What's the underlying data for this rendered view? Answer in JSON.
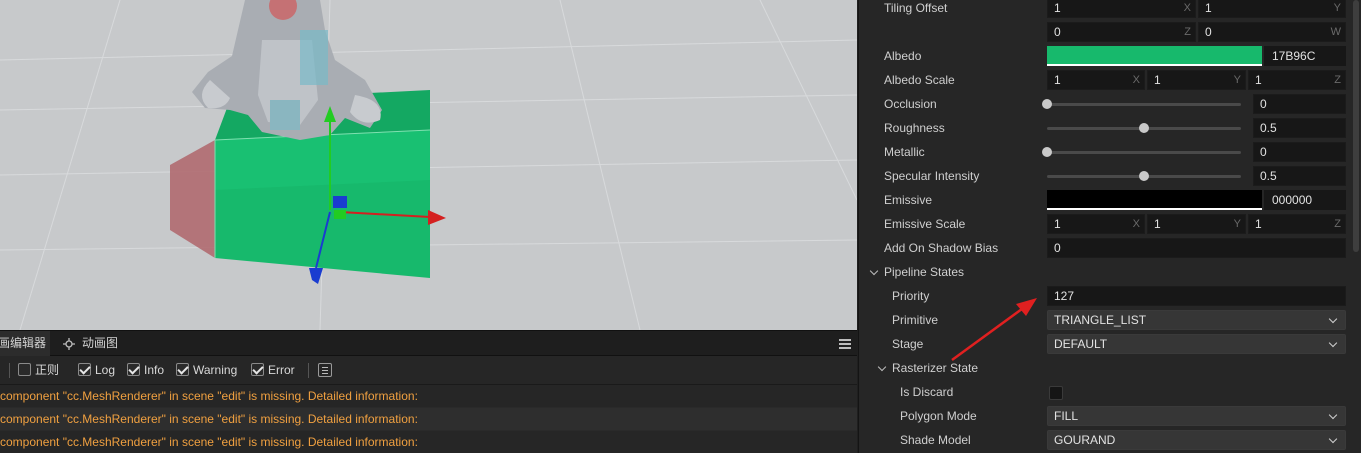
{
  "console": {
    "tabs": [
      "画编辑器",
      "动画图"
    ],
    "filters": [
      {
        "label": "正则",
        "checked": false
      },
      {
        "label": "Log",
        "checked": true
      },
      {
        "label": "Info",
        "checked": true
      },
      {
        "label": "Warning",
        "checked": true
      },
      {
        "label": "Error",
        "checked": true
      }
    ],
    "logs": [
      "component \"cc.MeshRenderer\" in scene \"edit\" is missing. Detailed information:",
      "component \"cc.MeshRenderer\" in scene \"edit\" is missing. Detailed information:",
      "component \"cc.MeshRenderer\" in scene \"edit\" is missing. Detailed information:"
    ]
  },
  "inspector": {
    "tiling_offset": {
      "label": "Tiling Offset",
      "x": "1",
      "y": "1",
      "z": "0",
      "w": "0",
      "axes": [
        "X",
        "Y",
        "Z",
        "W"
      ]
    },
    "albedo": {
      "label": "Albedo",
      "hex": "17B96C",
      "color": "#17B96C"
    },
    "albedo_scale": {
      "label": "Albedo Scale",
      "x": "1",
      "y": "1",
      "z": "1"
    },
    "occlusion": {
      "label": "Occlusion",
      "value": "0",
      "fraction": 0.0
    },
    "roughness": {
      "label": "Roughness",
      "value": "0.5",
      "fraction": 0.5
    },
    "metallic": {
      "label": "Metallic",
      "value": "0",
      "fraction": 0.0
    },
    "specular": {
      "label": "Specular Intensity",
      "value": "0.5",
      "fraction": 0.5
    },
    "emissive": {
      "label": "Emissive",
      "hex": "000000",
      "color": "#000000"
    },
    "emissive_scale": {
      "label": "Emissive Scale",
      "x": "1",
      "y": "1",
      "z": "1"
    },
    "shadow_bias": {
      "label": "Add On Shadow Bias",
      "value": "0"
    },
    "pipeline_states": {
      "label": "Pipeline States"
    },
    "priority": {
      "label": "Priority",
      "value": "127"
    },
    "primitive": {
      "label": "Primitive",
      "value": "TRIANGLE_LIST"
    },
    "stage": {
      "label": "Stage",
      "value": "DEFAULT"
    },
    "rasterizer_state": {
      "label": "Rasterizer State"
    },
    "is_discard": {
      "label": "Is Discard",
      "checked": false
    },
    "polygon_mode": {
      "label": "Polygon Mode",
      "value": "FILL"
    },
    "shade_model": {
      "label": "Shade Model",
      "value": "GOURAND"
    }
  },
  "axis_labels": {
    "x": "X",
    "y": "Y",
    "z": "Z"
  },
  "colors": {
    "accent_green": "#17B96C",
    "log_warning": "#F0A040",
    "annotation_arrow": "#E02020"
  }
}
